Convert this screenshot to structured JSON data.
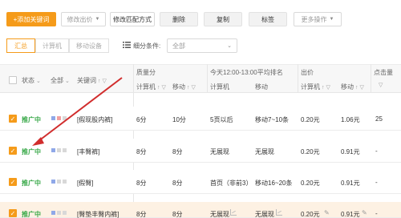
{
  "toolbar": {
    "add_keyword": "+添加关键词",
    "edit_bid": "修改出价",
    "edit_match": "修改匹配方式",
    "delete": "删除",
    "copy": "复制",
    "tag": "标签",
    "more": "更多操作"
  },
  "filters": {
    "segments": [
      "汇总",
      "计算机",
      "移动设备"
    ],
    "detail_condition_label": "细分条件:",
    "detail_condition_value": "全部"
  },
  "table": {
    "group_headers": {
      "quality": "质量分",
      "rank": "今天12:00-13:00平均排名",
      "bid": "出价",
      "clicks": "点击量"
    },
    "sub_headers": {
      "status": "状态",
      "all": "全部",
      "keyword": "关键词",
      "pc": "计算机",
      "mobile": "移动",
      "pc_rank": "计算机",
      "mobile_rank": "移动",
      "pc_bid": "计算机",
      "mobile_bid": "移动"
    },
    "rows": [
      {
        "status": "推广中",
        "keyword": "[假现股内裤]",
        "quality_pc": "6分",
        "quality_mobile": "10分",
        "rank_pc": "5页以后",
        "rank_mobile": "移动7~10条",
        "bid_pc": "0.20元",
        "bid_mobile": "1.06元",
        "clicks": "25"
      },
      {
        "status": "推广中",
        "keyword": "[丰臀裤]",
        "quality_pc": "8分",
        "quality_mobile": "8分",
        "rank_pc": "无展现",
        "rank_mobile": "无展现",
        "bid_pc": "0.20元",
        "bid_mobile": "0.91元",
        "clicks": "-"
      },
      {
        "status": "推广中",
        "keyword": "[假臀]",
        "quality_pc": "8分",
        "quality_mobile": "8分",
        "rank_pc": "首页（非前3）",
        "rank_mobile": "移动16~20条",
        "bid_pc": "0.20元",
        "bid_mobile": "0.91元",
        "clicks": "-"
      },
      {
        "status": "推广中",
        "keyword": "[臀垫丰臀内裤]",
        "quality_pc": "8分",
        "quality_mobile": "8分",
        "rank_pc": "无展现",
        "rank_mobile": "无展现",
        "bid_pc": "0.20元",
        "bid_mobile": "0.91元",
        "clicks": "-"
      }
    ]
  },
  "colors": {
    "accent": "#f59b1a",
    "status_green": "#3aa94a",
    "annotation_red": "#d12d2d",
    "highlight_row": "#fdf1e3"
  }
}
